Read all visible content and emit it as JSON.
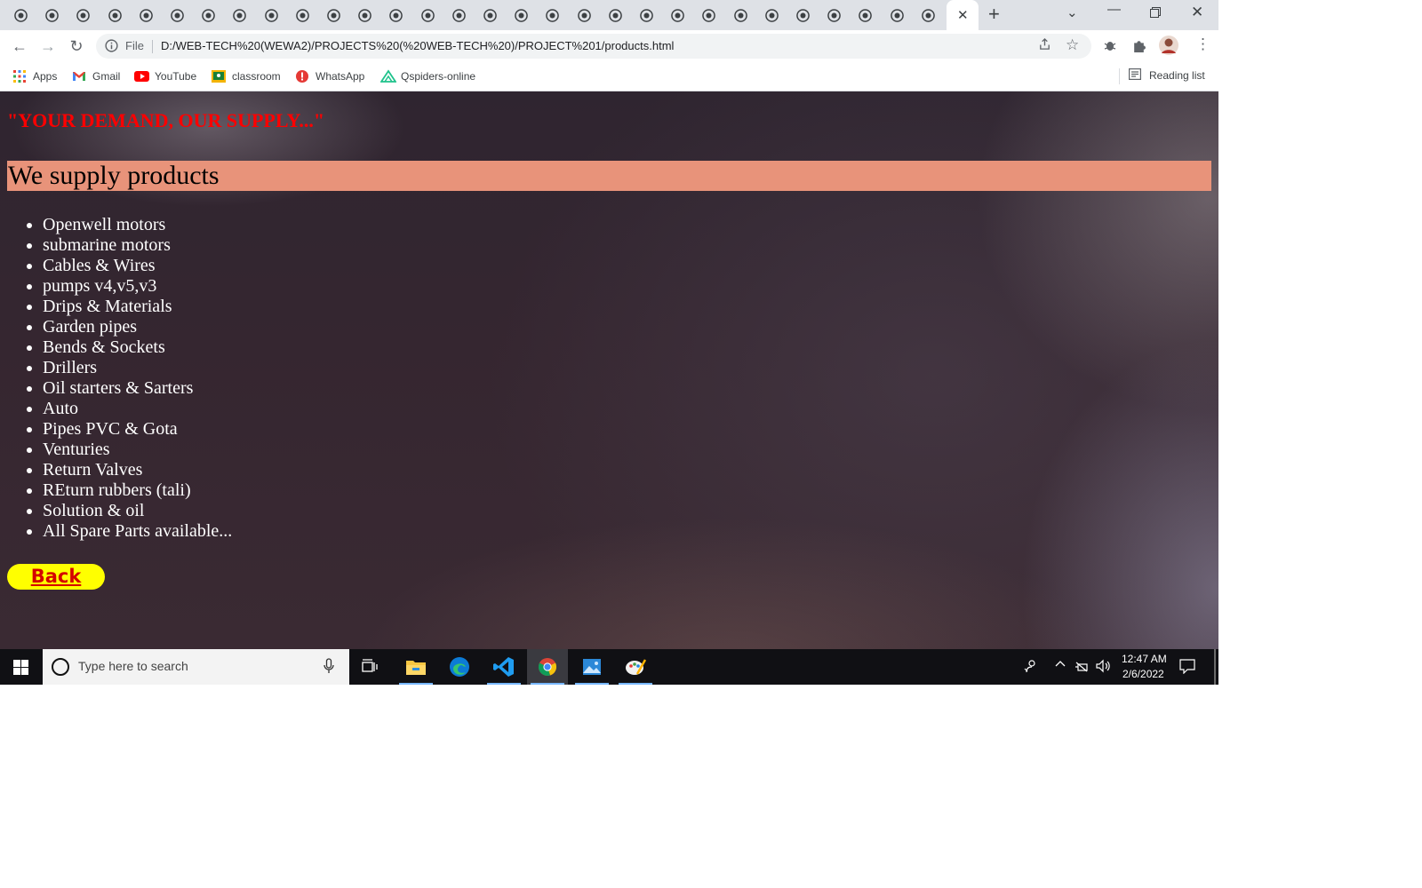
{
  "browser": {
    "url": "D:/WEB-TECH%20(WEWA2)/PROJECTS%20(%20WEB-TECH%20)/PROJECT%201/products.html",
    "scheme_label": "File",
    "bookmarks": [
      {
        "label": "Apps",
        "icon": "apps-grid-icon"
      },
      {
        "label": "Gmail",
        "icon": "gmail-icon"
      },
      {
        "label": "YouTube",
        "icon": "youtube-icon"
      },
      {
        "label": "classroom",
        "icon": "classroom-icon"
      },
      {
        "label": "WhatsApp",
        "icon": "whatsapp-icon"
      },
      {
        "label": "Qspiders-online",
        "icon": "qspiders-icon"
      }
    ],
    "reading_list_label": "Reading list"
  },
  "page": {
    "slogan": "\"YOUR DEMAND, OUR SUPPLY...\"",
    "heading": "We supply products",
    "products": [
      "Openwell motors",
      "submarine motors",
      "Cables & Wires",
      "pumps v4,v5,v3",
      "Drips & Materials",
      "Garden pipes",
      "Bends & Sockets",
      "Drillers",
      "Oil starters & Sarters",
      "Auto",
      "Pipes PVC & Gota",
      "Venturies",
      "Return Valves",
      "REturn rubbers (tali)",
      "Solution & oil",
      "All Spare Parts available..."
    ],
    "back_label": "Back",
    "colors": {
      "slogan": "#ff0000",
      "heading_bg": "#e8937a",
      "back_bg": "#ffff00",
      "back_text": "#d40000"
    }
  },
  "taskbar": {
    "search_placeholder": "Type here to search",
    "time": "12:47 AM",
    "date": "2/6/2022"
  }
}
